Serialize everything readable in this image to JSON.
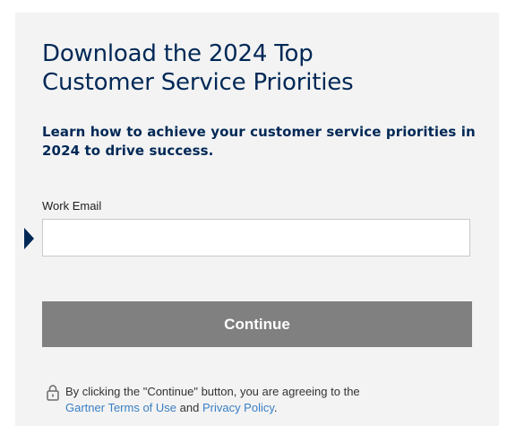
{
  "form": {
    "title_line1": "Download the 2024 Top",
    "title_line2": "Customer Service Priorities",
    "subtitle_line1": "Learn how to achieve your customer service priorities in",
    "subtitle_line2": "2024 to drive success.",
    "email_label": "Work Email",
    "email_value": "",
    "continue_label": "Continue"
  },
  "disclaimer": {
    "text_before": "By clicking the \"Continue\" button, you are agreeing to the",
    "terms_link": "Gartner Terms of Use",
    "and_text": " and ",
    "privacy_link": "Privacy Policy",
    "period": ".",
    "icon": "lock-icon"
  },
  "colors": {
    "heading": "#002856",
    "button_bg": "#808080",
    "link": "#3a7fc4",
    "card_bg": "#f3f3f3"
  }
}
